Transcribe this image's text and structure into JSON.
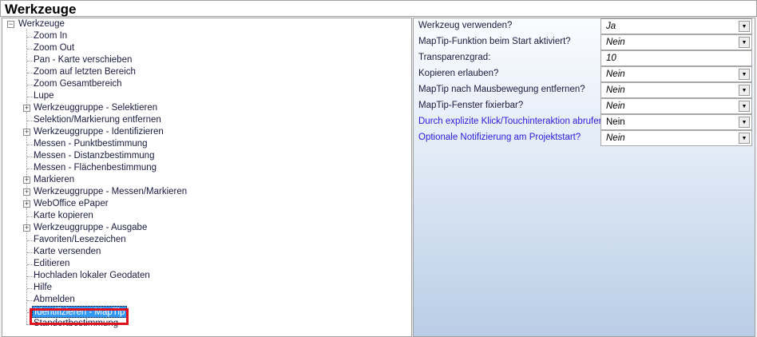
{
  "title": "Werkzeuge",
  "tree": {
    "root": "Werkzeuge",
    "items": [
      {
        "label": "Zoom In",
        "expandable": false
      },
      {
        "label": "Zoom Out",
        "expandable": false
      },
      {
        "label": "Pan - Karte verschieben",
        "expandable": false
      },
      {
        "label": "Zoom auf letzten Bereich",
        "expandable": false
      },
      {
        "label": "Zoom Gesamtbereich",
        "expandable": false
      },
      {
        "label": "Lupe",
        "expandable": false
      },
      {
        "label": "Werkzeuggruppe - Selektieren",
        "expandable": true
      },
      {
        "label": "Selektion/Markierung entfernen",
        "expandable": false
      },
      {
        "label": "Werkzeuggruppe - Identifizieren",
        "expandable": true
      },
      {
        "label": "Messen - Punktbestimmung",
        "expandable": false
      },
      {
        "label": "Messen - Distanzbestimmung",
        "expandable": false
      },
      {
        "label": "Messen - Flächenbestimmung",
        "expandable": false
      },
      {
        "label": "Markieren",
        "expandable": true
      },
      {
        "label": "Werkzeuggruppe - Messen/Markieren",
        "expandable": true
      },
      {
        "label": "WebOffice ePaper",
        "expandable": true
      },
      {
        "label": "Karte kopieren",
        "expandable": false
      },
      {
        "label": "Werkzeuggruppe - Ausgabe",
        "expandable": true
      },
      {
        "label": "Favoriten/Lesezeichen",
        "expandable": false
      },
      {
        "label": "Karte versenden",
        "expandable": false
      },
      {
        "label": "Editieren",
        "expandable": false
      },
      {
        "label": "Hochladen lokaler Geodaten",
        "expandable": false
      },
      {
        "label": "Hilfe",
        "expandable": false
      },
      {
        "label": "Abmelden",
        "expandable": false
      },
      {
        "label": "Identifizieren - MapTip",
        "expandable": false,
        "selected": true
      },
      {
        "label": "Standortbestimmung",
        "expandable": false
      }
    ]
  },
  "properties": [
    {
      "label": "Werkzeug verwenden?",
      "value": "Ja",
      "dropdown": true
    },
    {
      "label": "MapTip-Funktion beim Start aktiviert?",
      "value": "Nein",
      "dropdown": true
    },
    {
      "label": "Transparenzgrad:",
      "value": "10",
      "dropdown": false
    },
    {
      "label": "Kopieren erlauben?",
      "value": "Nein",
      "dropdown": true
    },
    {
      "label": "MapTip nach Mausbewegung entfernen?",
      "value": "Nein",
      "dropdown": true
    },
    {
      "label": "MapTip-Fenster fixierbar?",
      "value": "Nein",
      "dropdown": true
    },
    {
      "label": "Durch explizite Klick/Touchinteraktion abrufen?",
      "value": "Nein",
      "dropdown": true,
      "highlight": true,
      "plain": true
    },
    {
      "label": "Optionale Notifizierung am Projektstart?",
      "value": "Nein",
      "dropdown": true,
      "highlight": true
    }
  ]
}
